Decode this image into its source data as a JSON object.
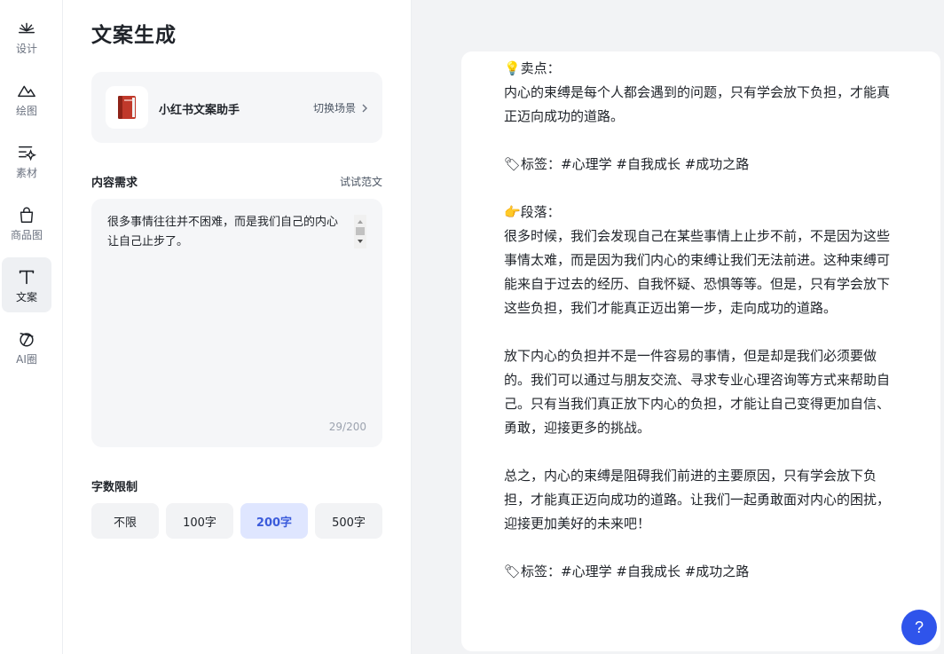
{
  "sidebar": {
    "items": [
      {
        "label": "设计",
        "icon": "design-icon"
      },
      {
        "label": "绘图",
        "icon": "mountain-icon"
      },
      {
        "label": "素材",
        "icon": "material-icon"
      },
      {
        "label": "商品图",
        "icon": "shopping-bag-icon"
      },
      {
        "label": "文案",
        "icon": "text-t-icon",
        "active": true
      },
      {
        "label": "AI圈",
        "icon": "ai-circle-icon"
      }
    ]
  },
  "main": {
    "title": "文案生成",
    "scene": {
      "name": "小红书文案助手",
      "switch_label": "切换场景",
      "icon": "red-book-icon"
    },
    "content_label": "内容需求",
    "try_example": "试试范文",
    "input_value": "很多事情往往并不困难，而是我们自己的内心让自己止步了。",
    "char_count": "29/200",
    "limit_label": "字数限制",
    "limits": [
      "不限",
      "100字",
      "200字",
      "500字"
    ],
    "selected_limit": "200字"
  },
  "result": {
    "text": "💡卖点：\n内心的束缚是每个人都会遇到的问题，只有学会放下负担，才能真正迈向成功的道路。\n\n🏷标签：#心理学 #自我成长 #成功之路\n\n👉段落：\n很多时候，我们会发现自己在某些事情上止步不前，不是因为这些事情太难，而是因为我们内心的束缚让我们无法前进。这种束缚可能来自于过去的经历、自我怀疑、恐惧等等。但是，只有学会放下这些负担，我们才能真正迈出第一步，走向成功的道路。\n\n放下内心的负担并不是一件容易的事情，但是却是我们必须要做的。我们可以通过与朋友交流、寻求专业心理咨询等方式来帮助自己。只有当我们真正放下内心的负担，才能让自己变得更加自信、勇敢，迎接更多的挑战。\n\n总之，内心的束缚是阻碍我们前进的主要原因，只有学会放下负担，才能真正迈向成功的道路。让我们一起勇敢面对内心的困扰，迎接更加美好的未来吧！\n\n🏷标签：#心理学 #自我成长 #成功之路"
  },
  "help": {
    "label": "?"
  },
  "colors": {
    "accent": "#2f54eb",
    "selected_bg": "#dfe6ff",
    "panel_bg": "#f2f3f5"
  }
}
